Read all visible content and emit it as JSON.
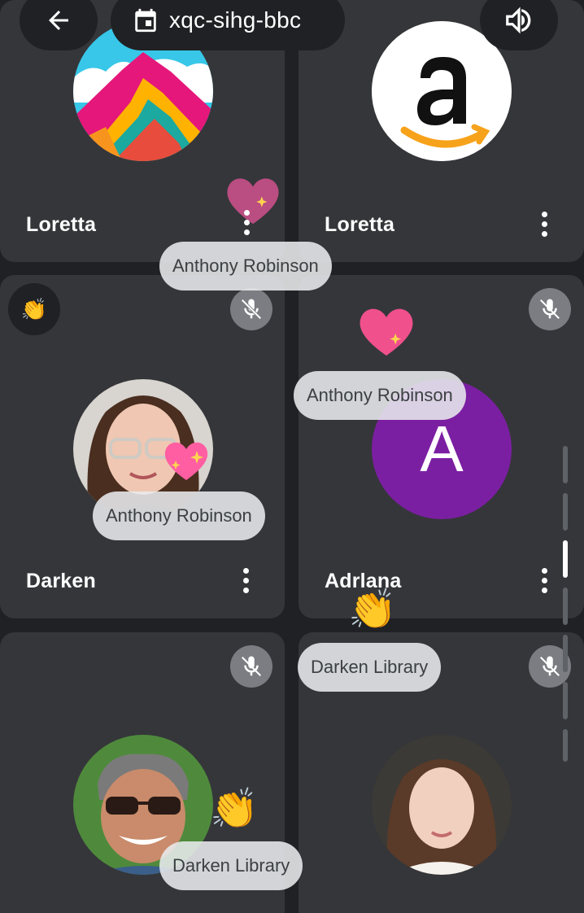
{
  "meeting": {
    "code": "xqc-sihg-bbc"
  },
  "tiles": [
    {
      "name": "Loretta"
    },
    {
      "name": "Loretta"
    },
    {
      "name": "Darken"
    },
    {
      "name": "Adrlana",
      "initial": "A"
    },
    {
      "name": ""
    },
    {
      "name": ""
    }
  ],
  "reactions": [
    {
      "sender": "Anthony Robinson",
      "emoji": "heart"
    },
    {
      "sender": "Anthony Robinson",
      "emoji": "heart"
    },
    {
      "sender": "Anthony Robinson",
      "emoji": "sparkling-heart"
    },
    {
      "sender": "Darken Library",
      "emoji": "clapping-hands"
    },
    {
      "sender": "Darken Library",
      "emoji": "clapping-hands"
    }
  ],
  "hand_raise_emoji": "👏",
  "colors": {
    "background": "#202124",
    "tile": "#35363a",
    "accent_avatar": "#7b1fa2",
    "pill": "#e8eaed"
  }
}
